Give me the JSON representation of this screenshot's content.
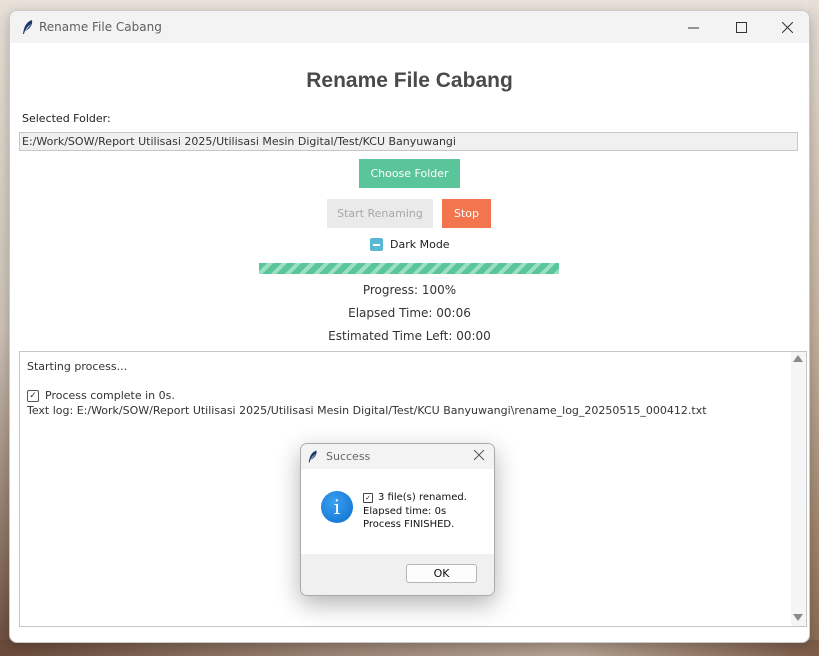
{
  "window": {
    "title": "Rename File Cabang",
    "icon": "feather-icon"
  },
  "app": {
    "heading": "Rename File Cabang",
    "folder_label": "Selected Folder:",
    "folder_path": "E:/Work/SOW/Report Utilisasi 2025/Utilisasi Mesin Digital/Test/KCU Banyuwangi",
    "choose_folder": "Choose Folder",
    "start_renaming": "Start Renaming",
    "stop": "Stop",
    "dark_mode": "Dark Mode",
    "progress_value": 1.0,
    "progress_text": "Progress: 100%",
    "elapsed_text": "Elapsed Time: 00:06",
    "eta_text": "Estimated Time Left: 00:00"
  },
  "log": {
    "line1": "Starting process...",
    "line2": "Process complete in 0s.",
    "line3": "Text log: E:/Work/SOW/Report Utilisasi 2025/Utilisasi Mesin Digital/Test/KCU Banyuwangi\\rename_log_20250515_000412.txt"
  },
  "dialog": {
    "title": "Success",
    "message1": "3 file(s) renamed.",
    "message2": "Elapsed time: 0s",
    "message3": "Process FINISHED.",
    "ok": "OK"
  },
  "colors": {
    "accent_green": "#5ac59a",
    "stop_orange": "#f2754e",
    "toggle_blue": "#5bb8d2"
  }
}
